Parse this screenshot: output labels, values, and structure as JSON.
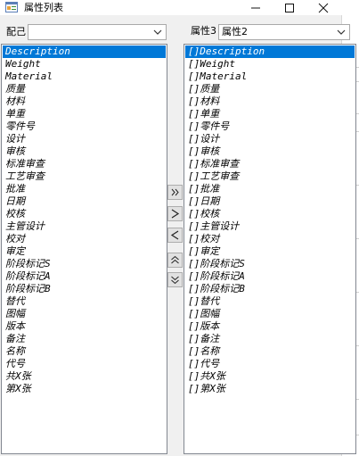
{
  "window": {
    "title": "属性列表"
  },
  "left": {
    "combo_label": "配己",
    "combo_value": "",
    "items": [
      "Description",
      "Weight",
      "Material",
      "质量",
      "材料",
      "单重",
      "零件号",
      "设计",
      "审核",
      "标准审查",
      "工艺审查",
      "批准",
      "日期",
      "校核",
      "主管设计",
      "校对",
      "审定",
      "阶段标记S",
      "阶段标记A",
      "阶段标记B",
      "替代",
      "图幅",
      "版本",
      "备注",
      "名称",
      "代号",
      "共X张",
      "第X张"
    ],
    "selected_index": 0
  },
  "right": {
    "combo_label": "属性3",
    "combo_value": "属性2",
    "items": [
      "[]Description",
      "[]Weight",
      "[]Material",
      "[]质量",
      "[]材料",
      "[]单重",
      "[]零件号",
      "[]设计",
      "[]审核",
      "[]标准审查",
      "[]工艺审查",
      "[]批准",
      "[]日期",
      "[]校核",
      "[]主管设计",
      "[]校对",
      "[]审定",
      "[]阶段标记S",
      "[]阶段标记A",
      "[]阶段标记B",
      "[]替代",
      "[]图幅",
      "[]版本",
      "[]备注",
      "[]名称",
      "[]代号",
      "[]共X张",
      "[]第X张"
    ],
    "selected_index": 0
  },
  "buttons": {
    "add_all": "»",
    "add": ">",
    "remove": "<",
    "move_up": "⋀",
    "move_down": "⋁"
  },
  "colors": {
    "selection": "#0078d7",
    "window_bg": "#f0f0f0"
  },
  "icons": [
    "app-icon",
    "minimize-icon",
    "maximize-icon",
    "close-icon",
    "chevron-down-icon",
    "double-right-icon",
    "right-arrow-icon",
    "left-arrow-icon",
    "double-up-icon",
    "double-down-icon"
  ]
}
